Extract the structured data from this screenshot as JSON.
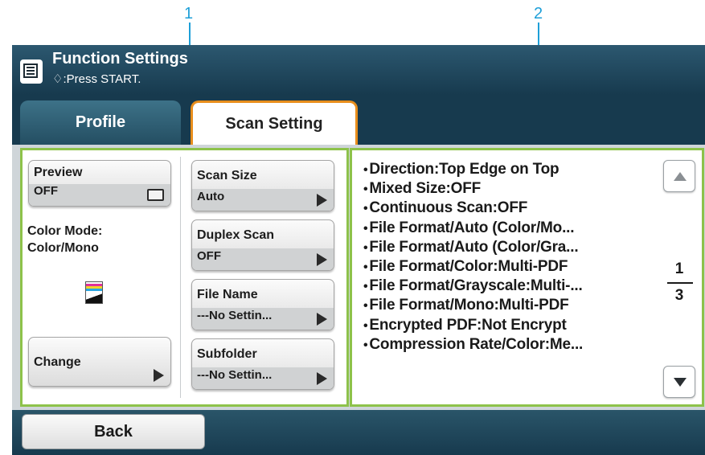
{
  "callouts": [
    "1",
    "2"
  ],
  "header": {
    "title": "Function Settings",
    "subtitle": "♢:Press START."
  },
  "tabs": {
    "profile": "Profile",
    "scan_setting": "Scan Setting"
  },
  "left_panel": {
    "preview": {
      "label": "Preview",
      "value": "OFF"
    },
    "color_mode": {
      "label": "Color Mode:",
      "value": "Color/Mono"
    },
    "change": "Change",
    "scan_size": {
      "label": "Scan Size",
      "value": "Auto"
    },
    "duplex_scan": {
      "label": "Duplex Scan",
      "value": "OFF"
    },
    "file_name": {
      "label": "File Name",
      "value": "---No Settin..."
    },
    "subfolder": {
      "label": "Subfolder",
      "value": "---No Settin..."
    }
  },
  "summary": {
    "items": [
      "Direction:Top Edge on Top",
      "Mixed Size:OFF",
      "Continuous Scan:OFF",
      "File Format/Auto (Color/Mo...",
      "File Format/Auto (Color/Gra...",
      "File Format/Color:Multi-PDF",
      "File Format/Grayscale:Multi-...",
      "File Format/Mono:Multi-PDF",
      "Encrypted PDF:Not Encrypt",
      "Compression Rate/Color:Me..."
    ],
    "page_current": "1",
    "page_total": "3"
  },
  "footer": {
    "back": "Back"
  },
  "colors": {
    "accent_green": "#8dc24a",
    "tab_orange": "#e88e1c",
    "header_dark": "#173a4e",
    "callout_blue": "#1e9fd8"
  }
}
